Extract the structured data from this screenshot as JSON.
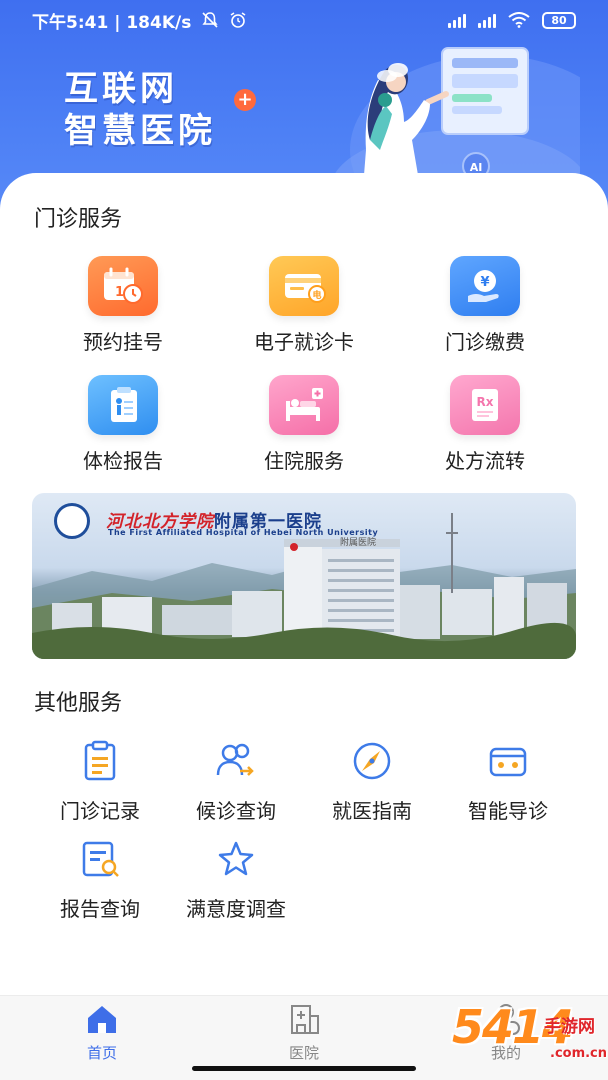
{
  "status_bar": {
    "time_speed": "下午5:41 | 184K/s",
    "battery": "80"
  },
  "hero": {
    "title_line1": "互联网",
    "title_line2": "智慧医院",
    "plus": "+",
    "ai_badge": "AI"
  },
  "outpatient": {
    "title": "门诊服务",
    "items": [
      {
        "label": "预约挂号",
        "icon": "calendar-clock-icon",
        "color": "#ff7a3d"
      },
      {
        "label": "电子就诊卡",
        "icon": "medical-card-icon",
        "color": "#ffb13a"
      },
      {
        "label": "门诊缴费",
        "icon": "yen-payment-icon",
        "color": "#3d8bf5"
      },
      {
        "label": "体检报告",
        "icon": "checkup-report-icon",
        "color": "#3c9cf2"
      },
      {
        "label": "住院服务",
        "icon": "hospital-bed-icon",
        "color": "#f77fb3"
      },
      {
        "label": "处方流转",
        "icon": "prescription-icon",
        "color": "#f77fb3"
      }
    ]
  },
  "banner": {
    "title_cn": "河北北方学院",
    "title_cn2": "附属第一医院",
    "subtitle": "The First Affiliated Hospital of Hebei North University",
    "building_sign": "附属医院"
  },
  "other": {
    "title": "其他服务",
    "items": [
      {
        "label": "门诊记录",
        "icon": "clipboard-icon"
      },
      {
        "label": "候诊查询",
        "icon": "people-queue-icon"
      },
      {
        "label": "就医指南",
        "icon": "compass-icon"
      },
      {
        "label": "智能导诊",
        "icon": "robot-icon"
      },
      {
        "label": "报告查询",
        "icon": "report-search-icon"
      },
      {
        "label": "满意度调查",
        "icon": "star-icon"
      }
    ]
  },
  "nav": {
    "items": [
      {
        "label": "首页",
        "icon": "home-icon",
        "active": true
      },
      {
        "label": "医院",
        "icon": "hospital-icon",
        "active": false
      },
      {
        "label": "我的",
        "icon": "user-icon",
        "active": false
      }
    ]
  },
  "watermark": {
    "number": "5414",
    "cn": "手游网",
    "domain": ".com.cn"
  },
  "colors": {
    "primary": "#3e6ee8",
    "hero_top": "#3f6ff0",
    "text": "#222222"
  }
}
